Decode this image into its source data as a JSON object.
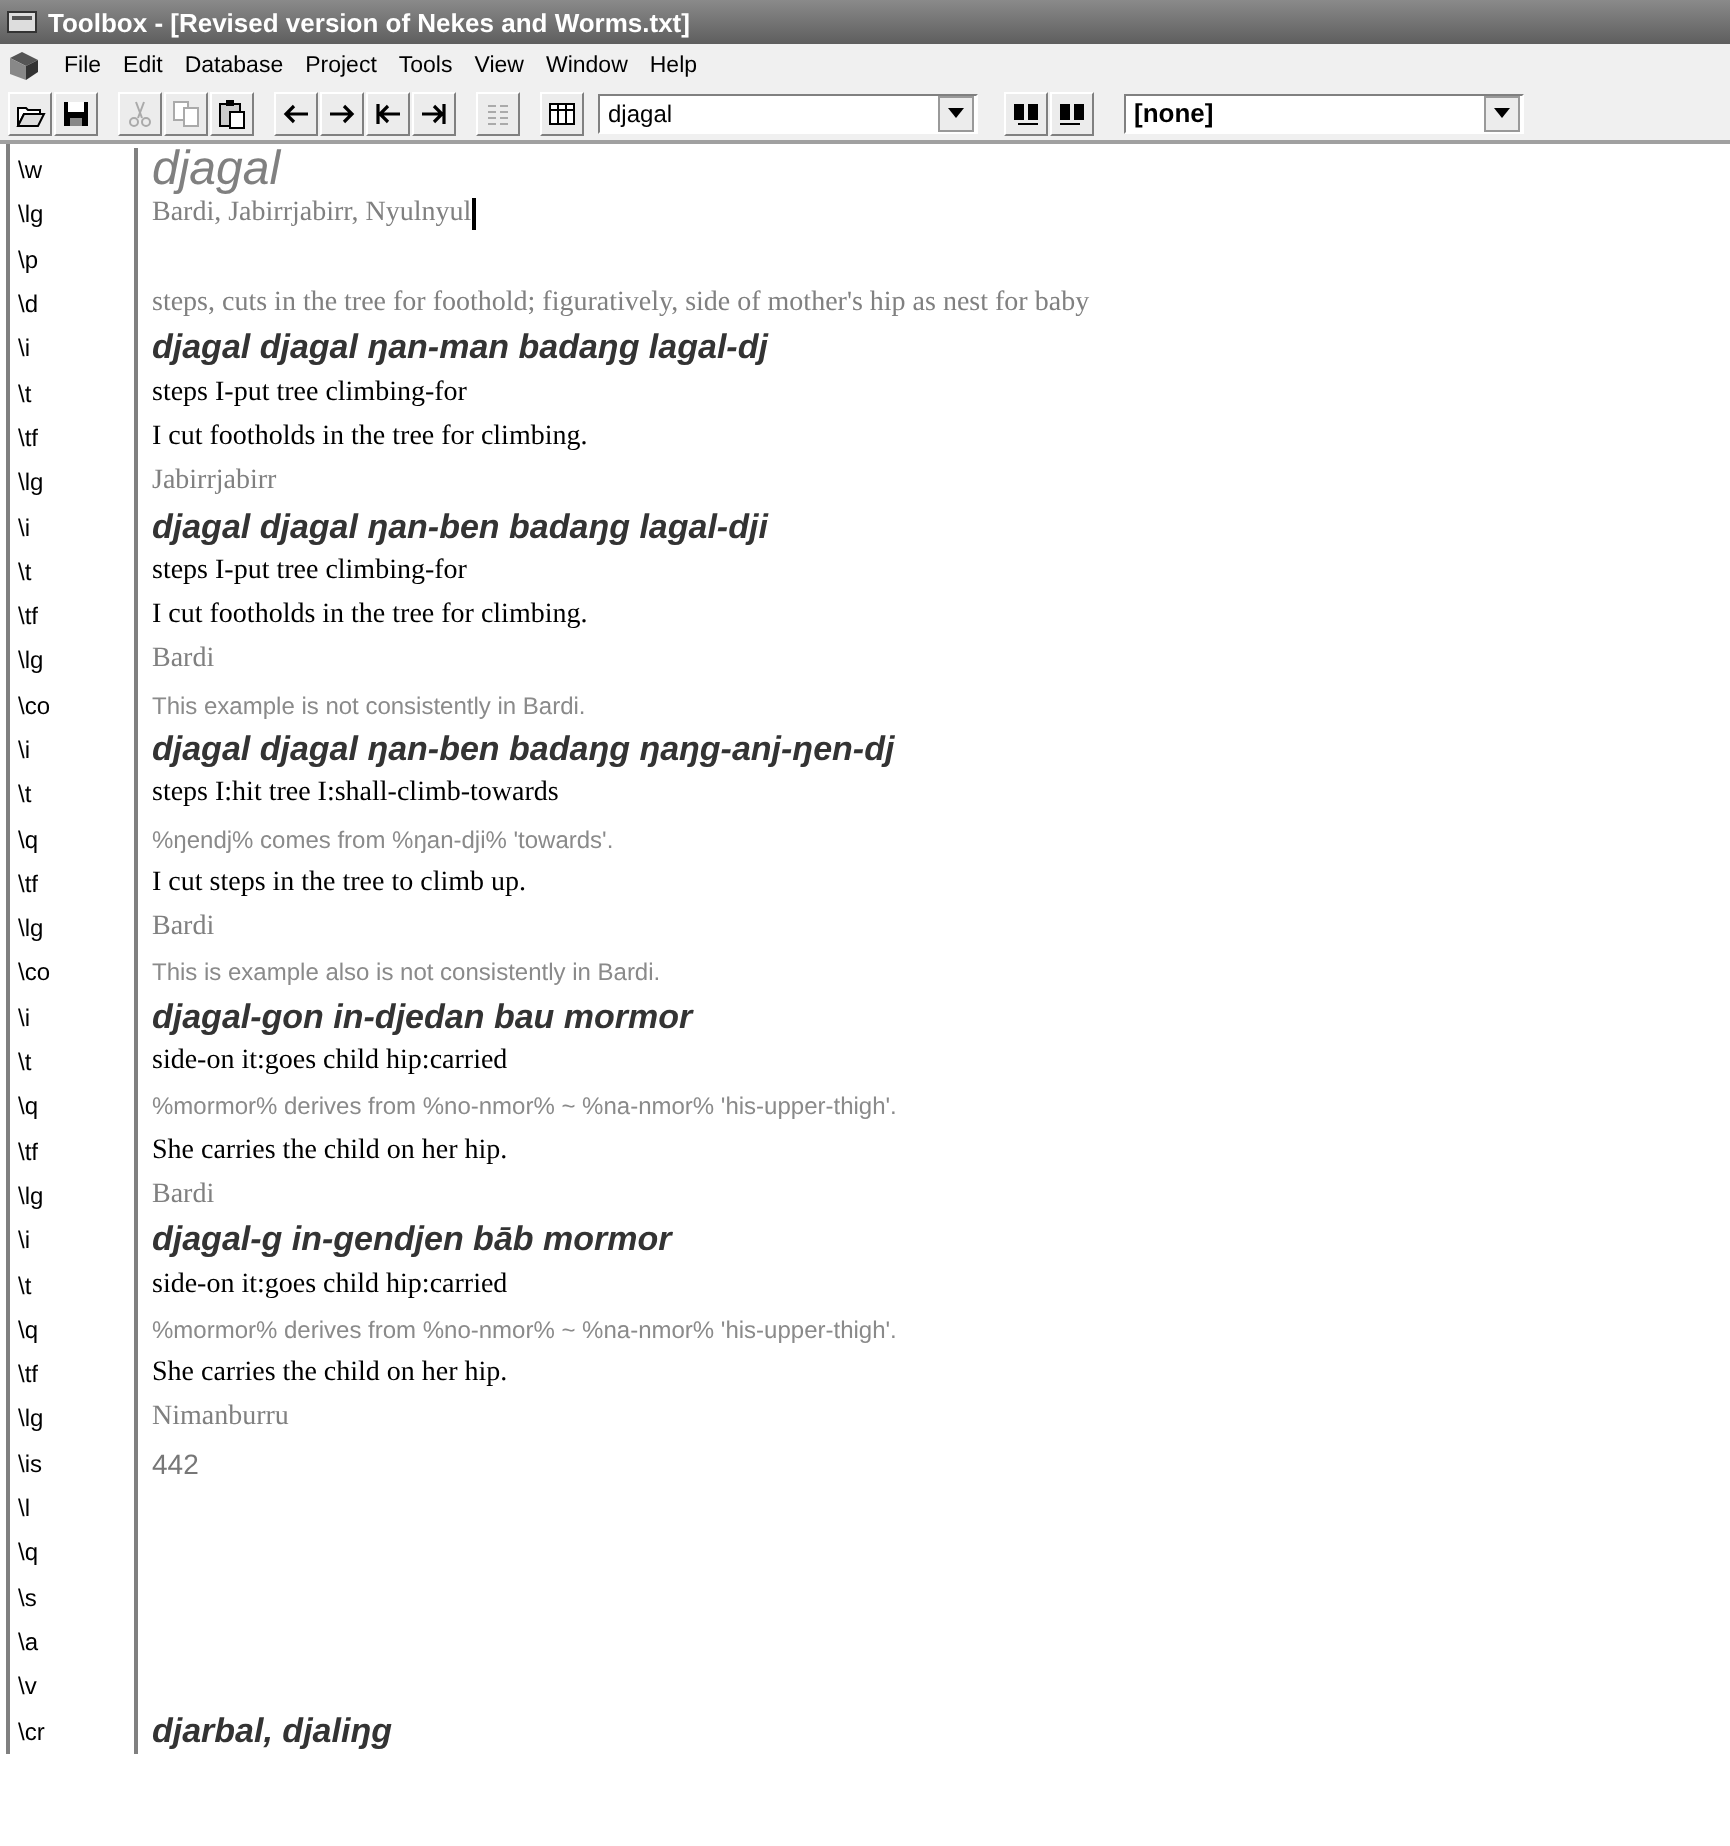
{
  "window": {
    "title": "Toolbox - [Revised version of Nekes and Worms.txt]"
  },
  "menu": [
    "File",
    "Edit",
    "Database",
    "Project",
    "Tools",
    "View",
    "Window",
    "Help"
  ],
  "toolbar": {
    "record_combo": {
      "value": "djagal"
    },
    "filter_combo": {
      "value": "[none]"
    },
    "buttons": [
      {
        "kind": "open",
        "disabled": false
      },
      {
        "kind": "save",
        "disabled": false
      },
      {
        "kind": "sep"
      },
      {
        "kind": "cut",
        "disabled": true
      },
      {
        "kind": "copy",
        "disabled": true
      },
      {
        "kind": "paste",
        "disabled": false
      },
      {
        "kind": "sep"
      },
      {
        "kind": "prev",
        "disabled": false
      },
      {
        "kind": "next",
        "disabled": false
      },
      {
        "kind": "first",
        "disabled": false
      },
      {
        "kind": "last",
        "disabled": false
      },
      {
        "kind": "sep"
      },
      {
        "kind": "browse",
        "disabled": true
      },
      {
        "kind": "sep"
      },
      {
        "kind": "view",
        "disabled": false
      }
    ]
  },
  "record": [
    {
      "marker": "\\w",
      "kind": "headword",
      "text": "djagal",
      "cursor": false
    },
    {
      "marker": "\\lg",
      "kind": "lang",
      "text": "Bardi, Jabirrjabirr, Nyulnyul",
      "cursor": true
    },
    {
      "marker": "\\p"
    },
    {
      "marker": "\\d",
      "kind": "lang",
      "text": "steps, cuts in the tree for foothold; figuratively, side of mother's hip as nest for baby",
      "cursor": false
    },
    {
      "marker": "\\i",
      "kind": "example",
      "text": "djagal djagal ŋan-man badaŋg lagal-dj",
      "cursor": false
    },
    {
      "marker": "\\t",
      "kind": "gloss",
      "text": "steps I-put tree climbing-for",
      "cursor": false
    },
    {
      "marker": "\\tf",
      "kind": "gloss",
      "text": "I cut footholds in the tree for climbing.",
      "cursor": false
    },
    {
      "marker": "\\lg",
      "kind": "lang",
      "text": "Jabirrjabirr",
      "cursor": false
    },
    {
      "marker": "\\i",
      "kind": "example",
      "text": "djagal djagal ŋan-ben badaŋg lagal-dji",
      "cursor": false
    },
    {
      "marker": "\\t",
      "kind": "gloss",
      "text": "steps I-put tree climbing-for",
      "cursor": false
    },
    {
      "marker": "\\tf",
      "kind": "gloss",
      "text": "I cut footholds in the tree for climbing.",
      "cursor": false
    },
    {
      "marker": "\\lg",
      "kind": "lang",
      "text": "Bardi",
      "cursor": false
    },
    {
      "marker": "\\co",
      "kind": "note",
      "text": "This example is not consistently in Bardi.",
      "cursor": false
    },
    {
      "marker": "\\i",
      "kind": "example",
      "text": "djagal djagal ŋan-ben badaŋg ŋaŋg-anj-ŋen-dj",
      "cursor": false
    },
    {
      "marker": "\\t",
      "kind": "gloss",
      "text": "steps I:hit tree I:shall-climb-towards",
      "cursor": false
    },
    {
      "marker": "\\q",
      "kind": "note",
      "text": "%ŋendj% comes from %ŋan-dji% 'towards'.",
      "cursor": false
    },
    {
      "marker": "\\tf",
      "kind": "gloss",
      "text": "I cut steps in the tree to climb up.",
      "cursor": false
    },
    {
      "marker": "\\lg",
      "kind": "lang",
      "text": "Bardi",
      "cursor": false
    },
    {
      "marker": "\\co",
      "kind": "note",
      "text": "This is example also is not consistently in Bardi.",
      "cursor": false
    },
    {
      "marker": "\\i",
      "kind": "example",
      "text": "djagal-gon in-djedan bau mormor",
      "cursor": false
    },
    {
      "marker": "\\t",
      "kind": "gloss",
      "text": "side-on it:goes child hip:carried",
      "cursor": false
    },
    {
      "marker": "\\q",
      "kind": "note",
      "text": "%mormor% derives from %no-nmor% ~ %na-nmor% 'his-upper-thigh'.",
      "cursor": false
    },
    {
      "marker": "\\tf",
      "kind": "gloss",
      "text": "She carries the child on her hip.",
      "cursor": false
    },
    {
      "marker": "\\lg",
      "kind": "lang",
      "text": "Bardi",
      "cursor": false
    },
    {
      "marker": "\\i",
      "kind": "example",
      "text": "djagal-g in-gendjen bāb mormor",
      "cursor": false
    },
    {
      "marker": "\\t",
      "kind": "gloss",
      "text": "side-on it:goes child hip:carried",
      "cursor": false
    },
    {
      "marker": "\\q",
      "kind": "note",
      "text": "%mormor% derives from %no-nmor% ~ %na-nmor% 'his-upper-thigh'.",
      "cursor": false
    },
    {
      "marker": "\\tf",
      "kind": "gloss",
      "text": "She carries the child on her hip.",
      "cursor": false
    },
    {
      "marker": "\\lg",
      "kind": "lang",
      "text": "Nimanburru",
      "cursor": false
    },
    {
      "marker": "\\is",
      "kind": "number",
      "text": "442",
      "cursor": false
    },
    {
      "marker": "\\l"
    },
    {
      "marker": "\\q"
    },
    {
      "marker": "\\s"
    },
    {
      "marker": "\\a"
    },
    {
      "marker": "\\v"
    },
    {
      "marker": "\\cr",
      "kind": "example",
      "text": "djarbal, djaliŋg",
      "cursor": false
    }
  ]
}
